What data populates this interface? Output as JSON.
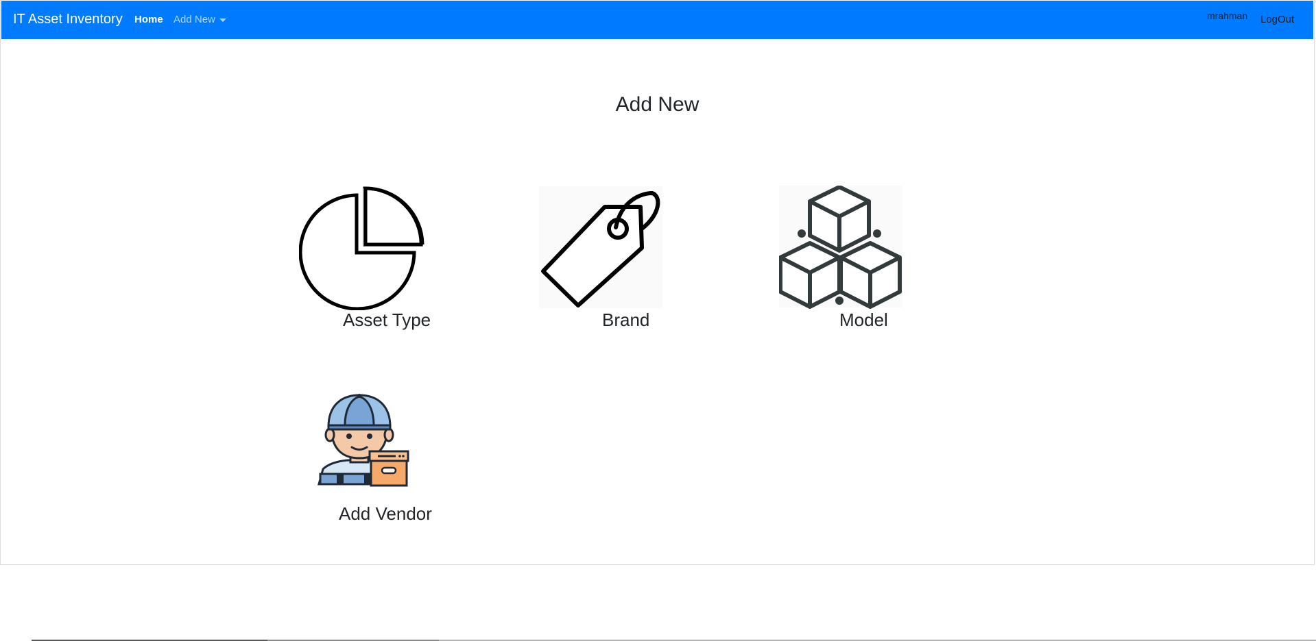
{
  "navbar": {
    "brand": "IT Asset Inventory",
    "home": "Home",
    "add_new": "Add New",
    "username": "mrahman",
    "logout": "LogOut",
    "background_color": "#007bff"
  },
  "main": {
    "title": "Add New",
    "tiles": [
      {
        "label": "Asset Type",
        "icon": "pie-chart-icon"
      },
      {
        "label": "Brand",
        "icon": "price-tag-icon"
      },
      {
        "label": "Model",
        "icon": "cubes-icon"
      },
      {
        "label": "Add Vendor",
        "icon": "vendor-person-icon"
      }
    ]
  }
}
